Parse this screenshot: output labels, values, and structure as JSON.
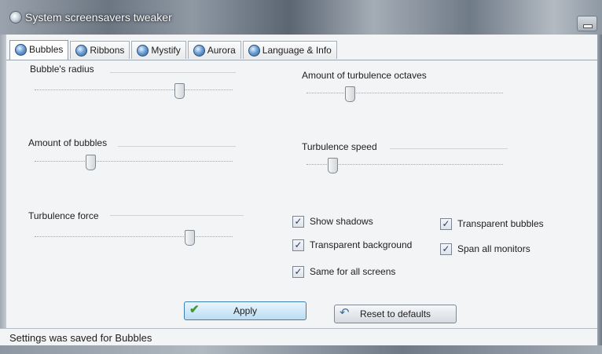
{
  "window": {
    "title": "System screensavers tweaker",
    "app_icon": "screensaver-app-icon",
    "minimize_icon": "minimize-icon"
  },
  "tabs": [
    {
      "label": "Bubbles",
      "icon": "bubbles-tab-icon",
      "active": true
    },
    {
      "label": "Ribbons",
      "icon": "ribbons-tab-icon",
      "active": false
    },
    {
      "label": "Mystify",
      "icon": "mystify-tab-icon",
      "active": false
    },
    {
      "label": "Aurora",
      "icon": "aurora-tab-icon",
      "active": false
    },
    {
      "label": "Language & Info",
      "icon": "info-tab-icon",
      "active": false
    }
  ],
  "sliders": {
    "bubble_radius": {
      "label": "Bubble's radius",
      "level": 0.73
    },
    "bubble_amount": {
      "label": "Amount of bubbles",
      "level": 0.28
    },
    "turbulence_force": {
      "label": "Turbulence force",
      "level": 0.78
    },
    "turbulence_octaves": {
      "label": "Amount of turbulence octaves",
      "level": 0.22
    },
    "turbulence_speed": {
      "label": "Turbulence speed",
      "level": 0.13
    }
  },
  "checkboxes": {
    "show_shadows": {
      "label": "Show shadows",
      "checked": true
    },
    "transparent_background": {
      "label": "Transparent background",
      "checked": true
    },
    "same_for_all_screens": {
      "label": "Same for all screens",
      "checked": true
    },
    "transparent_bubbles": {
      "label": "Transparent bubbles",
      "checked": true
    },
    "span_all_monitors": {
      "label": "Span all monitors",
      "checked": true
    }
  },
  "buttons": {
    "apply_label": "Apply",
    "apply_icon": "checkmark-icon",
    "reset_label": "Reset to defaults",
    "reset_icon": "reset-icon"
  },
  "status": {
    "text": "Settings was saved for Bubbles"
  },
  "colors": {
    "apply_accent": "#3c7fb1",
    "checkmark_green": "#3e9a2c",
    "check_tick": "#233f68"
  }
}
